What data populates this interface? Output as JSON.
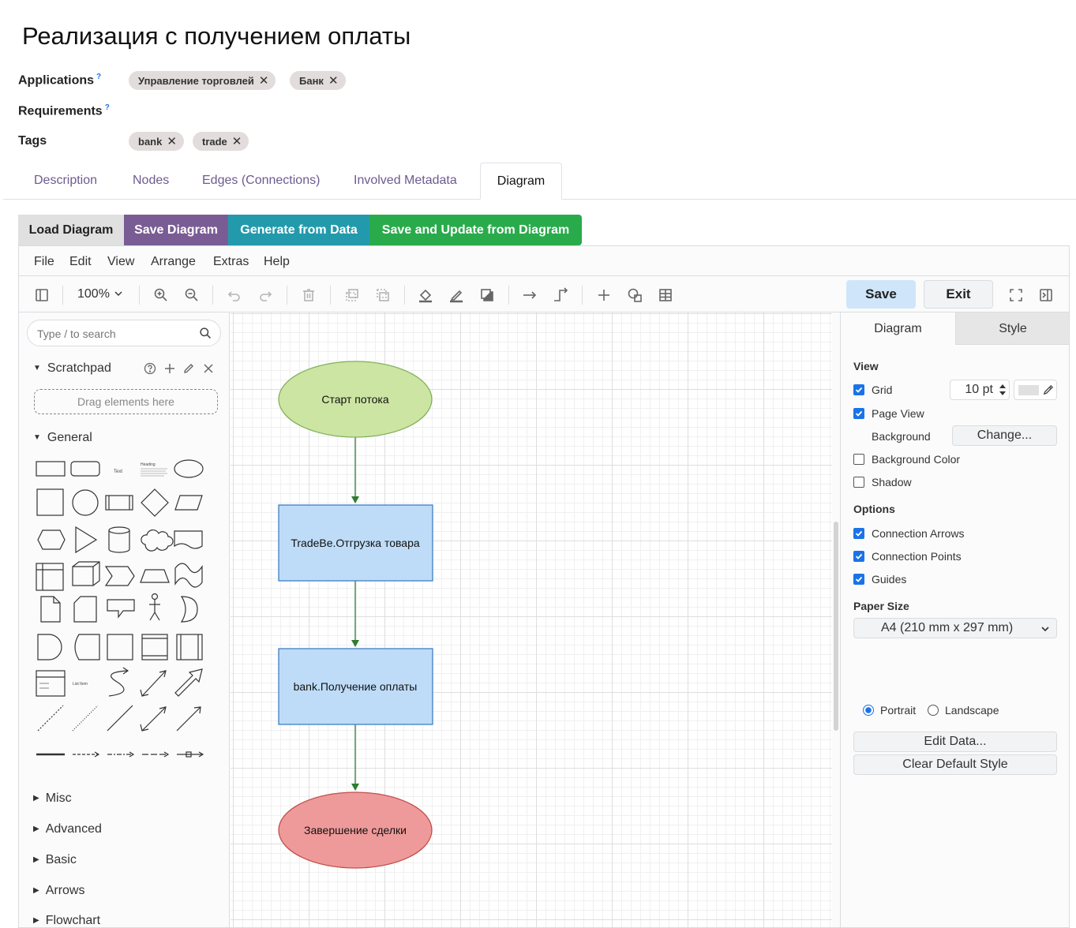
{
  "page": {
    "title": "Реализация с получением оплаты"
  },
  "fields": {
    "applications_label": "Applications",
    "requirements_label": "Requirements",
    "tags_label": "Tags",
    "help_mark": "?",
    "applications": [
      "Управление торговлей",
      "Банк"
    ],
    "tags": [
      "bank",
      "trade"
    ],
    "remove_mark": "✕"
  },
  "tabs": [
    "Description",
    "Nodes",
    "Edges (Connections)",
    "Involved Metadata",
    "Diagram"
  ],
  "buttons": {
    "load": "Load Diagram",
    "save": "Save Diagram",
    "generate": "Generate from Data",
    "update": "Save and Update from Diagram"
  },
  "colors": {
    "load_bg": "#e0e0e0",
    "save_bg": "#7a5c95",
    "generate_bg": "#229aac",
    "update_bg": "#29ab4b",
    "accent": "#1a73e8",
    "start_fill": "#cce5a3",
    "start_stroke": "#84b25c",
    "process_fill": "#bedcf7",
    "process_stroke": "#3f7fc4",
    "end_fill": "#ef9a9a",
    "end_stroke": "#c0504d",
    "edge": "#2e7d32"
  },
  "editor": {
    "menu": [
      "File",
      "Edit",
      "View",
      "Arrange",
      "Extras",
      "Help"
    ],
    "zoom": "100%",
    "save_label": "Save",
    "exit_label": "Exit",
    "search_placeholder": "Type / to search",
    "scratchpad_label": "Scratchpad",
    "drag_hint": "Drag elements here",
    "general_label": "General",
    "palette_text": "Text",
    "palette_heading": "Heading",
    "palette_list_item": "List Item",
    "collapsed_sections": [
      "Misc",
      "Advanced",
      "Basic",
      "Arrows",
      "Flowchart"
    ]
  },
  "diagram": {
    "nodes": [
      {
        "label": "Старт потока",
        "kind": "start"
      },
      {
        "label": "TradeBe.Отгрузка товара",
        "kind": "process"
      },
      {
        "label": "bank.Получение оплаты",
        "kind": "process"
      },
      {
        "label": "Завершение сделки",
        "kind": "end"
      }
    ]
  },
  "format_panel": {
    "tab_diagram": "Diagram",
    "tab_style": "Style",
    "view_heading": "View",
    "grid_label": "Grid",
    "grid_checked": true,
    "grid_size": "10 pt",
    "page_view_label": "Page View",
    "page_view_checked": true,
    "background_label": "Background",
    "change_label": "Change...",
    "background_color_label": "Background Color",
    "background_color_checked": false,
    "shadow_label": "Shadow",
    "shadow_checked": false,
    "options_heading": "Options",
    "connection_arrows_label": "Connection Arrows",
    "connection_arrows_checked": true,
    "connection_points_label": "Connection Points",
    "connection_points_checked": true,
    "guides_label": "Guides",
    "guides_checked": true,
    "paper_size_heading": "Paper Size",
    "paper_size_value": "A4 (210 mm x 297 mm)",
    "portrait_label": "Portrait",
    "landscape_label": "Landscape",
    "orientation": "portrait",
    "edit_data_label": "Edit Data...",
    "clear_style_label": "Clear Default Style"
  }
}
